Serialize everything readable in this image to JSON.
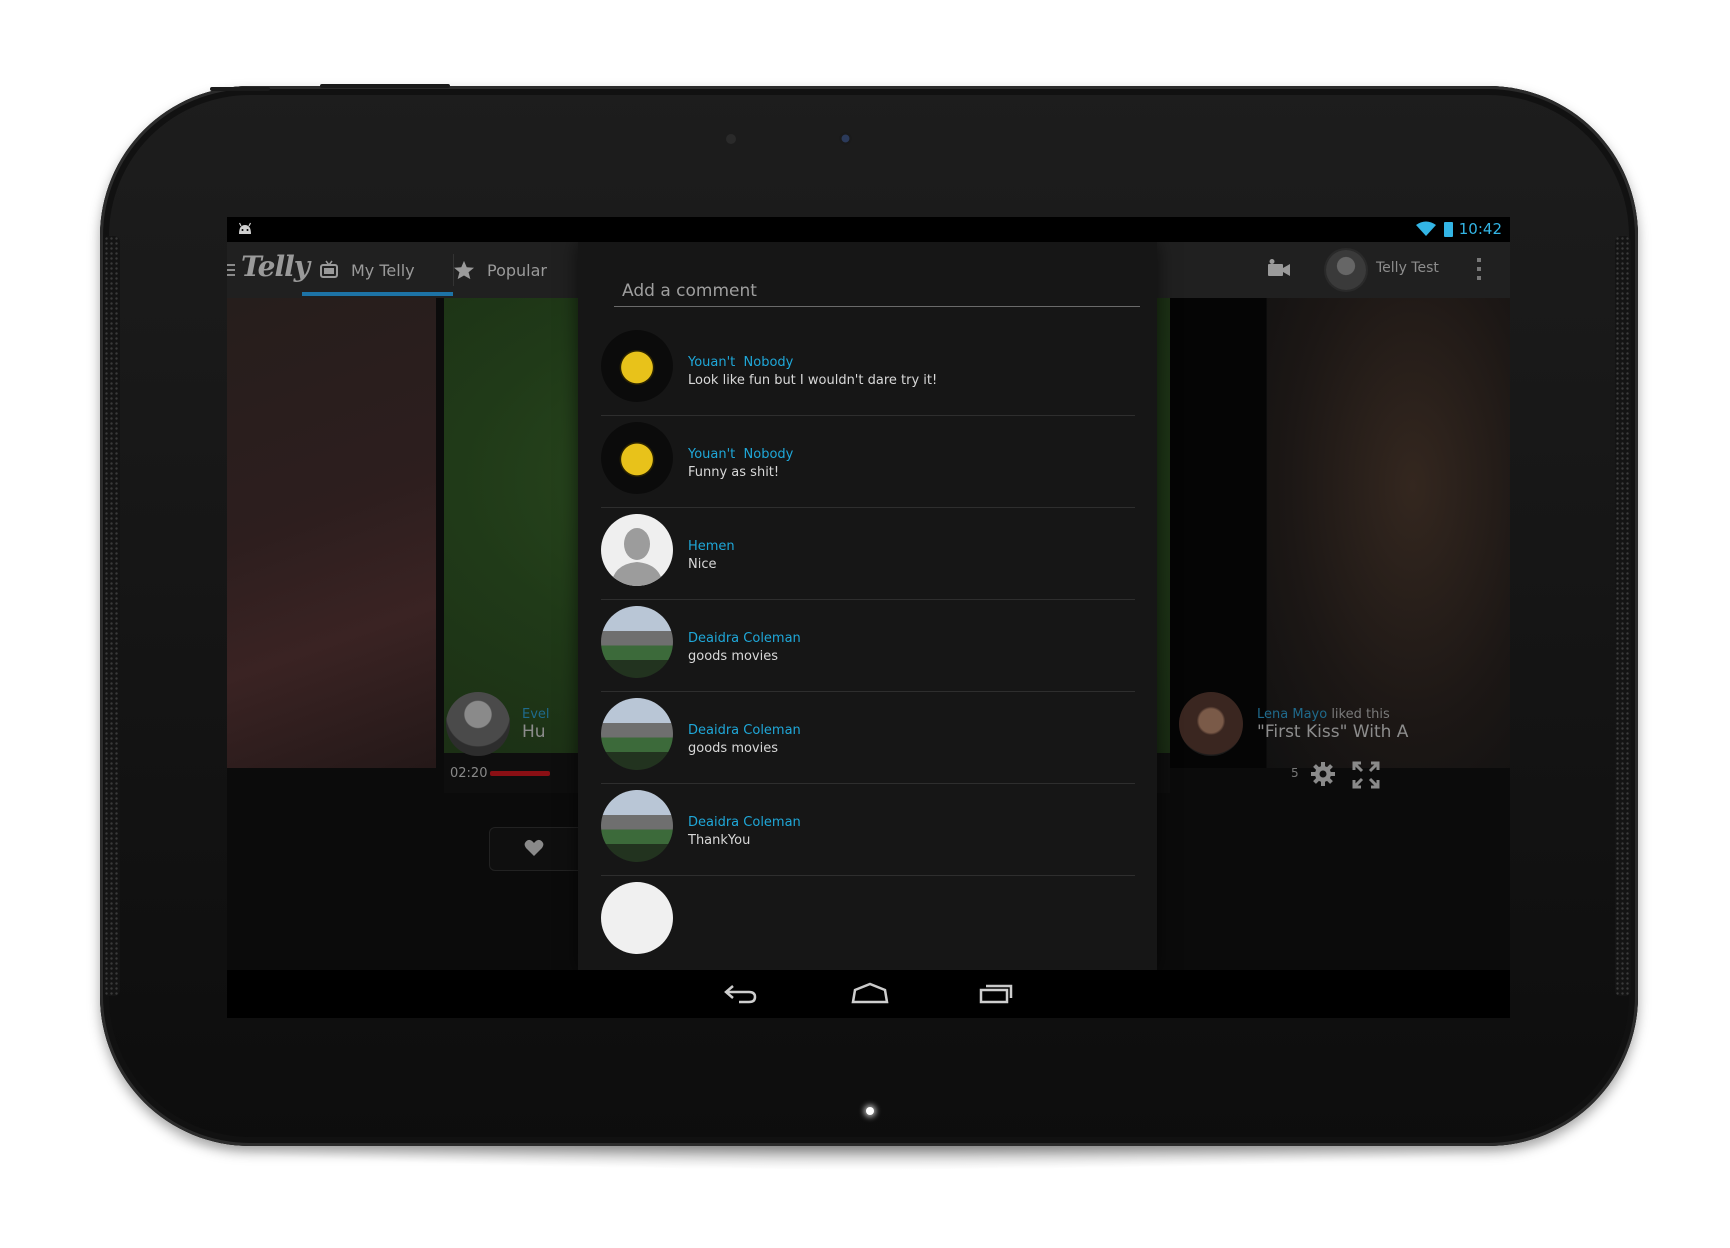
{
  "status": {
    "time": "10:42"
  },
  "app": {
    "logo": "Telly",
    "tabs": [
      {
        "label": "My Telly"
      },
      {
        "label": "Popular"
      }
    ],
    "user_name": "Telly Test"
  },
  "player": {
    "time": "02:20",
    "trailing": "5"
  },
  "feed": {
    "left": {
      "name": "Evel",
      "title": "Hu"
    },
    "right": {
      "name": "Lena Mayo",
      "action": " liked this",
      "title": "\"First Kiss\" With A"
    }
  },
  "dialog": {
    "placeholder": "Add a comment",
    "comments": [
      {
        "name": "Youan't  Nobody",
        "text": "Look like fun but I wouldn't dare try it!"
      },
      {
        "name": "Youan't  Nobody",
        "text": "Funny as shit!"
      },
      {
        "name": "Hemen",
        "text": "Nice"
      },
      {
        "name": "Deaidra Coleman",
        "text": "goods movies"
      },
      {
        "name": "Deaidra Coleman",
        "text": "goods movies"
      },
      {
        "name": "Deaidra Coleman",
        "text": "ThankYou"
      }
    ]
  },
  "icons": [
    "android-icon",
    "wifi-icon",
    "battery-icon",
    "drawer-icon",
    "tv-icon",
    "star-icon",
    "camcorder-icon",
    "overflow-icon",
    "gear-icon",
    "fullscreen-icon",
    "heart-icon",
    "back-icon",
    "home-icon",
    "recents-icon"
  ],
  "colors": {
    "accent": "#33b5e5",
    "link": "#1fa7d8",
    "dialog_bg": "#161616"
  }
}
